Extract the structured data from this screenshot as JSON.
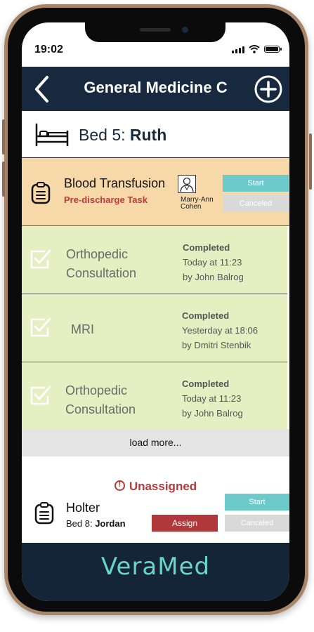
{
  "status_bar": {
    "time": "19:02",
    "signal_icon": "signal-icon",
    "wifi_icon": "wifi-icon",
    "battery_icon": "battery-icon"
  },
  "header": {
    "title": "General Medicine C",
    "back_icon": "chevron-left-icon",
    "add_icon": "plus-circle-icon"
  },
  "bed": {
    "prefix": "Bed 5: ",
    "patient": "Ruth",
    "icon": "bed-icon"
  },
  "active_task": {
    "name": "Blood Transfusion",
    "subtitle": "Pre-discharge Task",
    "assignee": "Marry-Ann Cohen",
    "start_label": "Start",
    "cancel_label": "Canceled"
  },
  "completed_tasks": [
    {
      "name_line1": "Orthopedic",
      "name_line2": "Consultation",
      "status": "Completed",
      "when": "Today at 11:23",
      "by": "by John Balrog"
    },
    {
      "name_line1": "MRI",
      "name_line2": "",
      "status": "Completed",
      "when": "Yesterday at 18:06",
      "by": "by Dmitri Stenbik"
    },
    {
      "name_line1": "Orthopedic",
      "name_line2": "Consultation",
      "status": "Completed",
      "when": "Today at 11:23",
      "by": "by John Balrog"
    }
  ],
  "load_more_label": "load more...",
  "unassigned": {
    "heading": "Unassigned",
    "task_name": "Holter",
    "bed_prefix": "Bed 8: ",
    "patient": "Jordan",
    "assign_label": "Assign",
    "start_label": "Start",
    "cancel_label": "Canceled"
  },
  "footer": {
    "brand": "VeraMed"
  },
  "colors": {
    "header_bg": "#17293e",
    "active_task_bg": "#f7d9a9",
    "completed_bg": "#e6efc2",
    "start_btn": "#6ccbca",
    "cancel_btn": "#d9d9d9",
    "alert_red": "#b5393b",
    "brand_teal": "#67d5cd"
  }
}
